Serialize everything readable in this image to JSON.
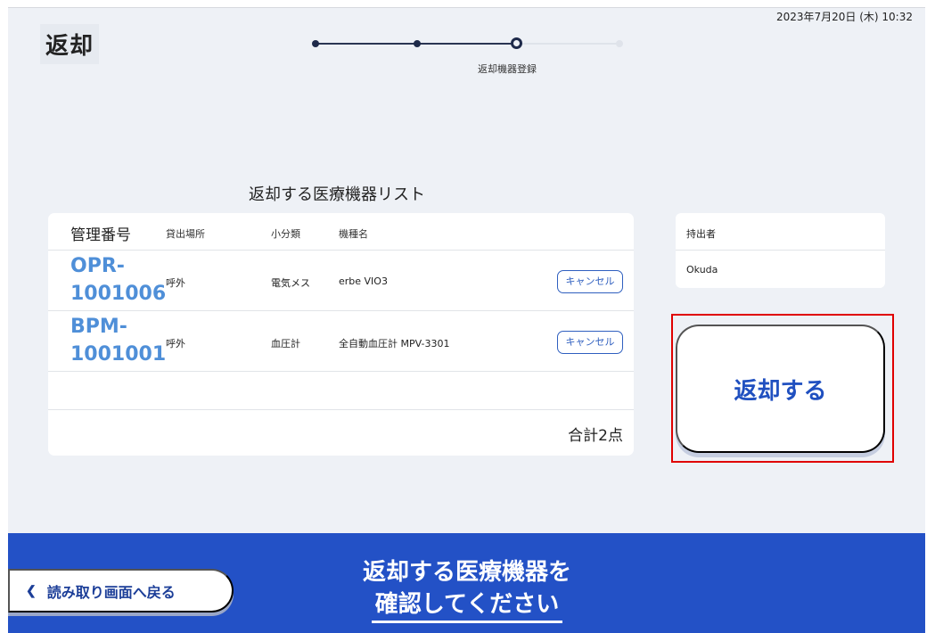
{
  "header": {
    "datetime": "2023年7月20日 (木) 10:32",
    "title": "返却"
  },
  "stepper": {
    "current_step_label": "返却機器登録",
    "total_steps": 4,
    "current_step": 3
  },
  "list": {
    "title": "返却する医療機器リスト",
    "columns": {
      "id": "管理番号",
      "location": "貸出場所",
      "category": "小分類",
      "model": "機種名"
    },
    "rows": [
      {
        "id_line1": "OPR-",
        "id_line2": "1001006",
        "location": "呼外",
        "category": "電気メス",
        "model": "erbe VIO3",
        "cancel_label": "キャンセル"
      },
      {
        "id_line1": "BPM-",
        "id_line2": "1001001",
        "location": "呼外",
        "category": "血圧計",
        "model": "全自動血圧計 MPV-3301",
        "cancel_label": "キャンセル"
      }
    ],
    "total": "合計2点"
  },
  "holder": {
    "label": "持出者",
    "name": "Okuda"
  },
  "return_button_label": "返却する",
  "footer": {
    "back_label": "読み取り画面へ戻る",
    "message_line1": "返却する医療機器を",
    "message_line2": "確認してください"
  },
  "colors": {
    "accent": "#2351c6",
    "id_text": "#4f8fd8",
    "highlight": "#e00000",
    "background": "#eef1f6"
  }
}
